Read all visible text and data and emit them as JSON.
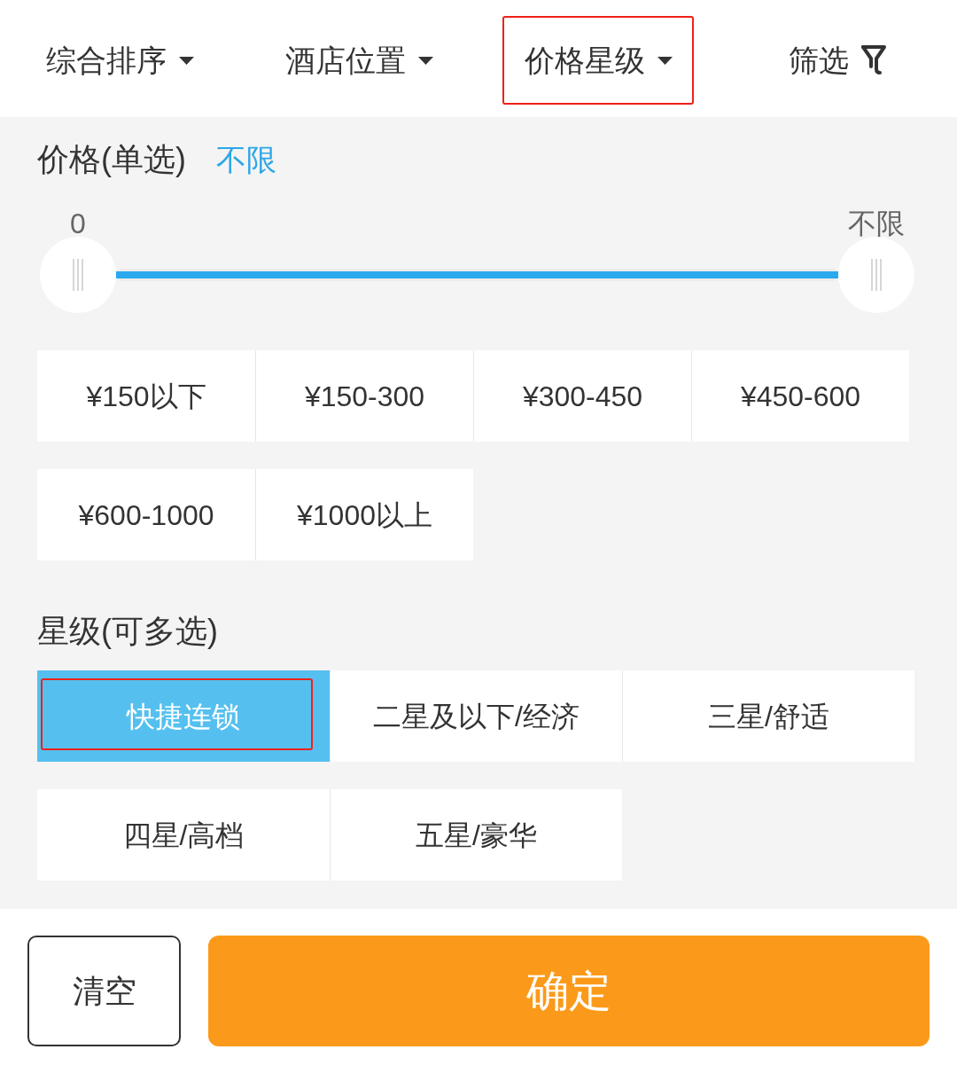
{
  "tabs": [
    {
      "label": "综合排序",
      "kind": "dropdown",
      "highlighted": false
    },
    {
      "label": "酒店位置",
      "kind": "dropdown",
      "highlighted": false
    },
    {
      "label": "价格星级",
      "kind": "dropdown",
      "highlighted": true
    },
    {
      "label": "筛选",
      "kind": "filter",
      "highlighted": false
    }
  ],
  "price": {
    "title": "价格(单选)",
    "value": "不限",
    "slider": {
      "min_label": "0",
      "max_label": "不限",
      "level": 1
    },
    "options": [
      {
        "label": "¥150以下",
        "selected": false
      },
      {
        "label": "¥150-300",
        "selected": false
      },
      {
        "label": "¥300-450",
        "selected": false
      },
      {
        "label": "¥450-600",
        "selected": false
      },
      {
        "label": "¥600-1000",
        "selected": false
      },
      {
        "label": "¥1000以上",
        "selected": false
      }
    ]
  },
  "stars": {
    "title": "星级(可多选)",
    "options": [
      {
        "label": "快捷连锁",
        "selected": true,
        "highlighted": true
      },
      {
        "label": "二星及以下/经济",
        "selected": false,
        "highlighted": false
      },
      {
        "label": "三星/舒适",
        "selected": false,
        "highlighted": false
      },
      {
        "label": "四星/高档",
        "selected": false,
        "highlighted": false
      },
      {
        "label": "五星/豪华",
        "selected": false,
        "highlighted": false
      }
    ]
  },
  "buttons": [
    {
      "label": "清空",
      "kind": "secondary"
    },
    {
      "label": "确定",
      "kind": "primary"
    }
  ]
}
